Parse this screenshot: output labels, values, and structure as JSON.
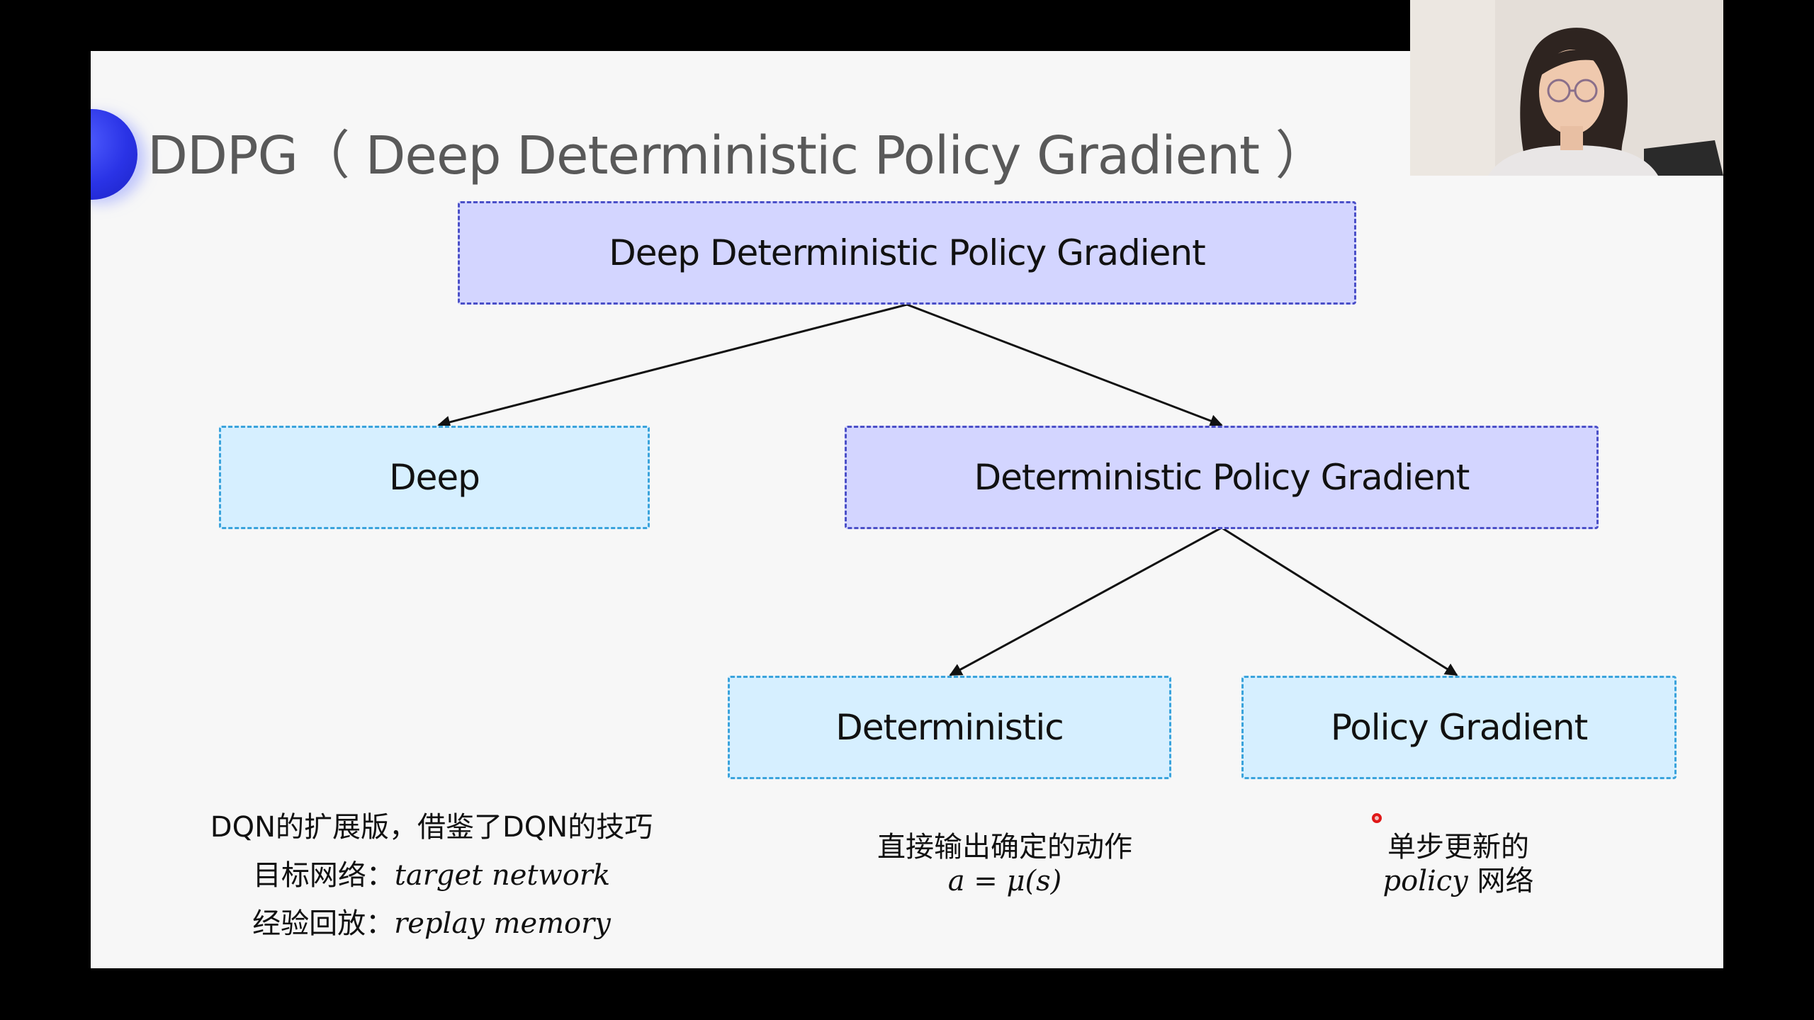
{
  "slide": {
    "title": "DDPG（ Deep Deterministic Policy Gradient ）",
    "root_box": "Deep Deterministic Policy Gradient",
    "deep_box": "Deep",
    "dpg_box": "Deterministic Policy Gradient",
    "deterministic_box": "Deterministic",
    "policy_gradient_box": "Policy Gradient",
    "note_deep": {
      "line1": "DQN的扩展版，借鉴了DQN的技巧",
      "line2_label": "目标网络：",
      "line2_math": "target network",
      "line3_label": "经验回放：",
      "line3_math": "replay memory"
    },
    "note_deterministic": {
      "line1": "直接输出确定的动作",
      "line2_math": "a = μ(s)"
    },
    "note_policy": {
      "line1": "单步更新的",
      "line2_math": "policy",
      "line2_text": " 网络"
    }
  },
  "colors": {
    "background": "#000000",
    "slide": "#f7f7f7",
    "purple_fill": "#d3d5ff",
    "purple_border": "#4b50c8",
    "blue_fill": "#d6efff",
    "blue_border": "#3aa3dc",
    "title": "#595959",
    "accent": "#2a33e6"
  },
  "icons": {
    "bullet": "title-bullet-circle",
    "pointer": "laser-pointer-dot"
  }
}
